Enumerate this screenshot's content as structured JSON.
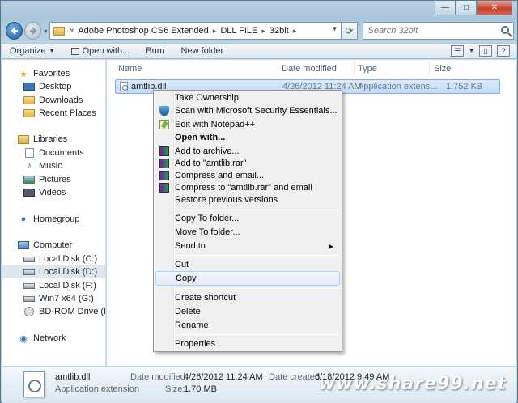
{
  "window": {
    "controls": {
      "minimize": "—",
      "maximize": "□",
      "close": "✕"
    }
  },
  "nav": {
    "history": "▾",
    "breadcrumb": [
      "«",
      "Adobe Photoshop CS6 Extended",
      "DLL FILE",
      "32bit"
    ],
    "refresh_icon": "refresh-icon",
    "search_placeholder": "Search 32bit"
  },
  "toolbar": {
    "organize": "Organize",
    "open_with": "Open with...",
    "burn": "Burn",
    "new_folder": "New folder"
  },
  "sidebar": {
    "favorites": "Favorites",
    "desktop": "Desktop",
    "downloads": "Downloads",
    "recent": "Recent Places",
    "libraries": "Libraries",
    "documents": "Documents",
    "music": "Music",
    "pictures": "Pictures",
    "videos": "Videos",
    "homegroup": "Homegroup",
    "computer": "Computer",
    "disk_c": "Local Disk (C:)",
    "disk_d": "Local Disk (D:)",
    "disk_f": "Local Disk (F:)",
    "disk_g": "Win7 x64 (G:)",
    "bd_rom": "BD-ROM Drive (H:) D",
    "network": "Network"
  },
  "columns": {
    "name": "Name",
    "date": "Date modified",
    "type": "Type",
    "size": "Size"
  },
  "file": {
    "name": "amtlib.dll",
    "date": "4/26/2012 11:24 AM",
    "type": "Application extens...",
    "size": "1,752 KB"
  },
  "context_menu": {
    "take_ownership": "Take Ownership",
    "scan": "Scan with Microsoft Security Essentials...",
    "edit_npp": "Edit with Notepad++",
    "open_with": "Open with...",
    "add_archive": "Add to archive...",
    "add_rar": "Add to \"amtlib.rar\"",
    "compress_email": "Compress and email...",
    "compress_rar_email": "Compress to \"amtlib.rar\" and email",
    "restore": "Restore previous versions",
    "copy_to": "Copy To folder...",
    "move_to": "Move To folder...",
    "send_to": "Send to",
    "cut": "Cut",
    "copy": "Copy",
    "create_shortcut": "Create shortcut",
    "delete": "Delete",
    "rename": "Rename",
    "properties": "Properties"
  },
  "details": {
    "name": "amtlib.dll",
    "kind": "Application extension",
    "date_modified_label": "Date modified:",
    "date_modified": "4/26/2012 11:24 AM",
    "date_created_label": "Date created:",
    "date_created": "6/18/2012 9:49 AM",
    "size_label": "Size:",
    "size": "1.70 MB",
    "watermark": "www.share99.net"
  }
}
